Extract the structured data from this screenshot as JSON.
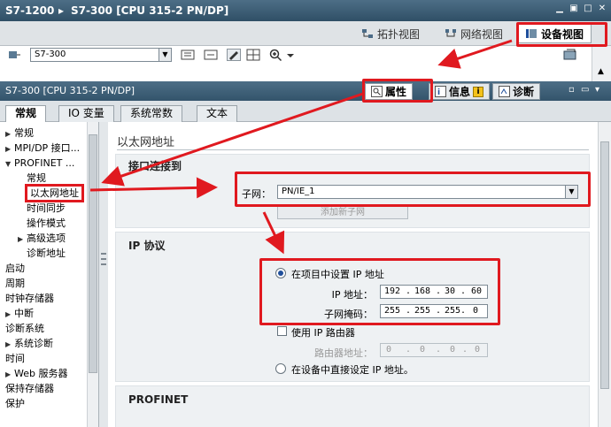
{
  "titlebar": {
    "crumb1": "S7-1200",
    "crumb2": "S7-300 [CPU 315-2 PN/DP]"
  },
  "view_tabs": [
    {
      "label": "拓扑视图",
      "icon": "topology-icon"
    },
    {
      "label": "网络视图",
      "icon": "network-icon"
    },
    {
      "label": "设备视图",
      "icon": "device-icon"
    }
  ],
  "toolbar": {
    "device_select_value": "S7-300"
  },
  "inspector": {
    "title": "S7-300 [CPU 315-2 PN/DP]",
    "tab_properties": "属性",
    "tab_info": "信息",
    "tab_info_badge": "i",
    "tab_diagnostics": "诊断"
  },
  "subtabs": [
    "常规",
    "IO 变量",
    "系统常数",
    "文本"
  ],
  "nav": [
    {
      "label": "常规",
      "level": 0,
      "expand": "▶"
    },
    {
      "label": "MPI/DP 接口...",
      "level": 0,
      "expand": "▶"
    },
    {
      "label": "PROFINET ...",
      "level": 0,
      "expand": "▼"
    },
    {
      "label": "常规",
      "level": 2,
      "expand": ""
    },
    {
      "label": "以太网地址",
      "level": 2,
      "expand": "",
      "selected": true
    },
    {
      "label": "时间同步",
      "level": 2,
      "expand": ""
    },
    {
      "label": "操作模式",
      "level": 2,
      "expand": ""
    },
    {
      "label": "高级选项",
      "level": 1,
      "expand": "▶"
    },
    {
      "label": "诊断地址",
      "level": 2,
      "expand": ""
    },
    {
      "label": "启动",
      "level": 0,
      "expand": ""
    },
    {
      "label": "周期",
      "level": 0,
      "expand": ""
    },
    {
      "label": "时钟存储器",
      "level": 0,
      "expand": ""
    },
    {
      "label": "中断",
      "level": 0,
      "expand": "▶"
    },
    {
      "label": "诊断系统",
      "level": 0,
      "expand": ""
    },
    {
      "label": "系统诊断",
      "level": 0,
      "expand": "▶"
    },
    {
      "label": "时间",
      "level": 0,
      "expand": ""
    },
    {
      "label": "Web 服务器",
      "level": 0,
      "expand": "▶"
    },
    {
      "label": "保持存储器",
      "level": 0,
      "expand": ""
    },
    {
      "label": "保护",
      "level": 0,
      "expand": ""
    }
  ],
  "content": {
    "section_title": "以太网地址",
    "interface_group_title": "接口连接到",
    "subnet_label": "子网：",
    "subnet_value": "PN/IE_1",
    "add_subnet_button": "添加新子网",
    "ip_group_title": "IP 协议",
    "radio_project_ip": "在项目中设置 IP 地址",
    "ip_label": "IP 地址：",
    "ip_octets": [
      "192",
      "168",
      "30",
      "60"
    ],
    "mask_label": "子网掩码：",
    "mask_octets": [
      "255",
      "255",
      "255",
      "0"
    ],
    "use_router_label": "使用 IP 路由器",
    "router_label": "路由器地址：",
    "router_octets": [
      "0",
      "0",
      "0",
      "0"
    ],
    "radio_device_ip": "在设备中直接设定 IP 地址。",
    "profinet_group_title": "PROFINET"
  },
  "colors": {
    "highlight": "#e0191f",
    "titlebar": "#3b5c74",
    "group_bg": "#eef1f3"
  }
}
